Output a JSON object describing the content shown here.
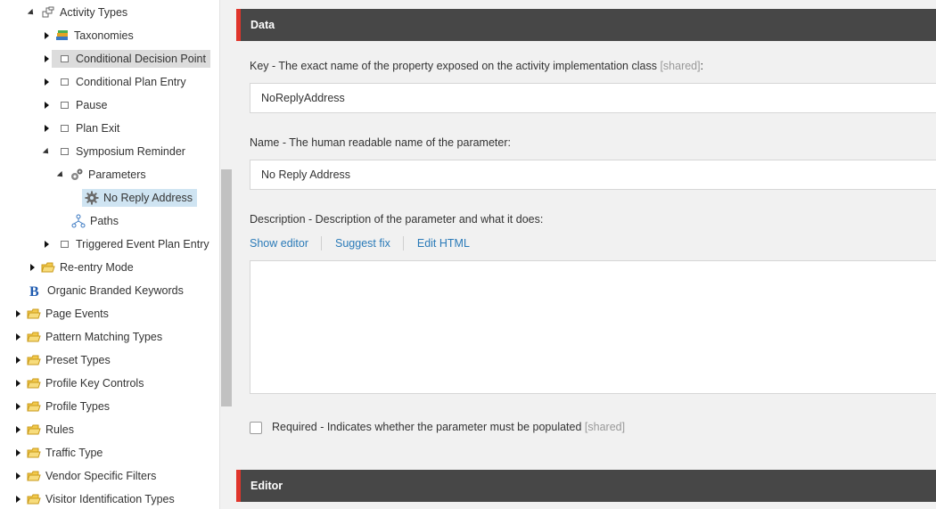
{
  "tree": {
    "items": [
      {
        "label": "Activity Types",
        "icon": "hierarchy-icon",
        "expanded": true
      },
      {
        "label": "Taxonomies",
        "icon": "books-icon"
      },
      {
        "label": "Conditional Decision Point",
        "icon": "item-icon",
        "selected": "grey"
      },
      {
        "label": "Conditional Plan Entry",
        "icon": "item-icon"
      },
      {
        "label": "Pause",
        "icon": "item-icon"
      },
      {
        "label": "Plan Exit",
        "icon": "item-icon"
      },
      {
        "label": "Symposium Reminder",
        "icon": "item-icon",
        "expanded": true
      },
      {
        "label": "Parameters",
        "icon": "gears-icon",
        "expanded": true
      },
      {
        "label": "No Reply Address",
        "icon": "gear-icon",
        "selected": "blue"
      },
      {
        "label": "Paths",
        "icon": "paths-icon"
      },
      {
        "label": "Triggered Event Plan Entry",
        "icon": "item-icon"
      },
      {
        "label": "Re-entry Mode",
        "icon": "folder-icon"
      },
      {
        "label": "Organic Branded Keywords",
        "icon": "b-logo-icon"
      },
      {
        "label": "Page Events",
        "icon": "folder-icon"
      },
      {
        "label": "Pattern Matching Types",
        "icon": "folder-icon"
      },
      {
        "label": "Preset Types",
        "icon": "folder-icon"
      },
      {
        "label": "Profile Key Controls",
        "icon": "folder-icon"
      },
      {
        "label": "Profile Types",
        "icon": "folder-icon"
      },
      {
        "label": "Rules",
        "icon": "folder-icon"
      },
      {
        "label": "Traffic Type",
        "icon": "folder-icon"
      },
      {
        "label": "Vendor Specific Filters",
        "icon": "folder-icon"
      },
      {
        "label": "Visitor Identification Types",
        "icon": "folder-icon"
      }
    ]
  },
  "sections": {
    "data_title": "Data",
    "editor_title": "Editor"
  },
  "fields": {
    "key": {
      "label": "Key - The exact name of the property exposed on the activity implementation class",
      "shared": "[shared]",
      "suffix": ":",
      "value": "NoReplyAddress"
    },
    "name": {
      "label": "Name - The human readable name of the parameter:",
      "value": "No Reply Address"
    },
    "description": {
      "label": "Description - Description of the parameter and what it does:",
      "links": {
        "show_editor": "Show editor",
        "suggest_fix": "Suggest fix",
        "edit_html": "Edit HTML"
      },
      "value": ""
    },
    "required": {
      "label": "Required - Indicates whether the parameter must be populated",
      "shared": "[shared]",
      "checked": false
    }
  },
  "colors": {
    "accent": "#e0352b",
    "section_bar": "#474747",
    "link": "#2a7ab8"
  }
}
